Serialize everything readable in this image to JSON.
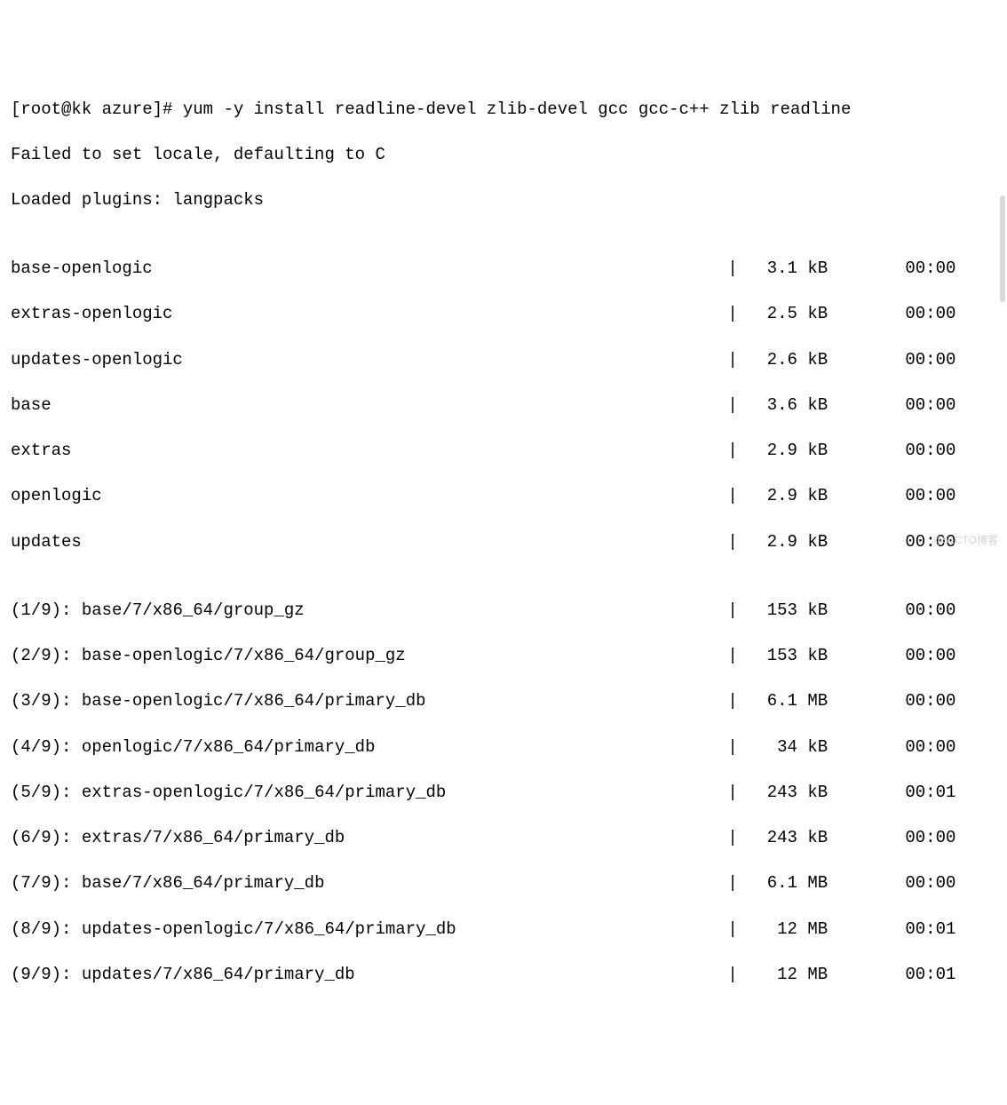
{
  "prompt": "[root@kk azure]# yum -y install readline-devel zlib-devel gcc gcc-c++ zlib readline",
  "messages": [
    "Failed to set locale, defaulting to C",
    "Loaded plugins: langpacks"
  ],
  "repos": [
    {
      "name": "base-openlogic",
      "size": "3.1 kB",
      "time": "00:00"
    },
    {
      "name": "extras-openlogic",
      "size": "2.5 kB",
      "time": "00:00"
    },
    {
      "name": "updates-openlogic",
      "size": "2.6 kB",
      "time": "00:00"
    },
    {
      "name": "base",
      "size": "3.6 kB",
      "time": "00:00"
    },
    {
      "name": "extras",
      "size": "2.9 kB",
      "time": "00:00"
    },
    {
      "name": "openlogic",
      "size": "2.9 kB",
      "time": "00:00"
    },
    {
      "name": "updates",
      "size": "2.9 kB",
      "time": "00:00"
    }
  ],
  "downloads": [
    {
      "index": "(1/9):",
      "path": "base/7/x86_64/group_gz",
      "size": "153 kB",
      "time": "00:00"
    },
    {
      "index": "(2/9):",
      "path": "base-openlogic/7/x86_64/group_gz",
      "size": "153 kB",
      "time": "00:00"
    },
    {
      "index": "(3/9):",
      "path": "base-openlogic/7/x86_64/primary_db",
      "size": "6.1 MB",
      "time": "00:00"
    },
    {
      "index": "(4/9):",
      "path": "openlogic/7/x86_64/primary_db",
      "size": " 34 kB",
      "time": "00:00"
    },
    {
      "index": "(5/9):",
      "path": "extras-openlogic/7/x86_64/primary_db",
      "size": "243 kB",
      "time": "00:01"
    },
    {
      "index": "(6/9):",
      "path": "extras/7/x86_64/primary_db",
      "size": "243 kB",
      "time": "00:00"
    },
    {
      "index": "(7/9):",
      "path": "base/7/x86_64/primary_db",
      "size": "6.1 MB",
      "time": "00:00"
    },
    {
      "index": "(8/9):",
      "path": "updates-openlogic/7/x86_64/primary_db",
      "size": " 12 MB",
      "time": "00:01"
    },
    {
      "index": "(9/9):",
      "path": "updates/7/x86_64/primary_db",
      "size": " 12 MB",
      "time": "00:01"
    }
  ],
  "watermark": "@51CTO博客"
}
